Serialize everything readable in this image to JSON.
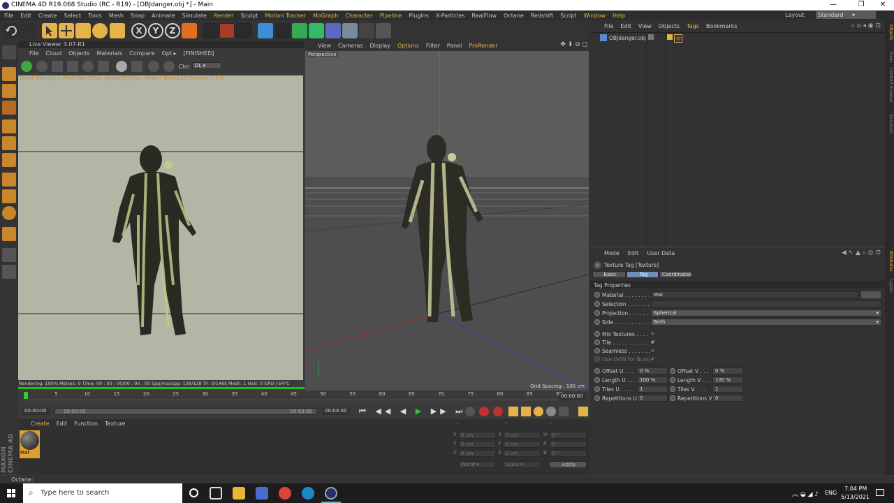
{
  "window": {
    "title": "CINEMA 4D R19.068 Studio (RC - R19) - [OBJdanger.obj *] - Main",
    "minimize": "—",
    "maximize": "❐",
    "close": "✕"
  },
  "menubar": {
    "items": [
      "File",
      "Edit",
      "Create",
      "Select",
      "Tools",
      "Mesh",
      "Snap",
      "Animate",
      "Simulate",
      "Render",
      "Sculpt",
      "Motion Tracker",
      "MoGraph",
      "Character",
      "Pipeline",
      "Plugins",
      "X-Particles",
      "RealFlow",
      "Octane",
      "Redshift",
      "Script",
      "Window",
      "Help"
    ],
    "layout_label": "Layout:",
    "layout_value": "Standard"
  },
  "live_viewer": {
    "title": "Live Viewer 3.07-R1",
    "menu": [
      "File",
      "Cloud",
      "Objects",
      "Materials",
      "Compare",
      "Opt ▸",
      "[FINISHED]"
    ],
    "chn_label": "Chn:",
    "chn_value": "DL",
    "status": "Check:0ms./1ms. MeshGen:23ms. Update[C]:0ms. Mesh:1 Nodes:13 Movable:1  0 0",
    "footer": "Rendering: 100%  Ms/sec: 0    Time: 00 : 00 : 00/00 : 00 : 00  Spp/maxspp: 128/128    Tri: 0/146k   Mesh: 1  Hair: 0      GPU:|    64°C"
  },
  "viewport": {
    "menu": [
      "View",
      "Cameras",
      "Display",
      "Options",
      "Filter",
      "Panel",
      "ProRender"
    ],
    "camera": "Perspective",
    "grid_spacing": "Grid Spacing : 100 cm"
  },
  "timeline": {
    "ticks": [
      "0",
      "5",
      "10",
      "15",
      "20",
      "25",
      "30",
      "35",
      "40",
      "45",
      "50",
      "55",
      "60",
      "65",
      "70",
      "75",
      "80",
      "85",
      "90"
    ],
    "end_frame": "00:00:00",
    "current": "00:00:00",
    "start": "00:00:00",
    "mid": "00:03:00",
    "end": "00:03:00"
  },
  "material_manager": {
    "menu": [
      "Create",
      "Edit",
      "Function",
      "Texture"
    ],
    "material_name": "Mat"
  },
  "coordinates": {
    "header_dash": "--",
    "rows": [
      {
        "a": "X",
        "av": "0 cm",
        "b": "X",
        "bv": "0 cm",
        "c": "H",
        "cv": "0 °"
      },
      {
        "a": "Y",
        "av": "0 cm",
        "b": "Y",
        "bv": "0 cm",
        "c": "P",
        "cv": "0 °"
      },
      {
        "a": "Z",
        "av": "0 cm",
        "b": "Z",
        "bv": "0 cm",
        "c": "B",
        "cv": "0 °"
      }
    ],
    "world": "World",
    "scale": "Scale",
    "apply": "Apply"
  },
  "object_manager": {
    "menu": [
      "File",
      "Edit",
      "View",
      "Objects",
      "Tags",
      "Bookmarks"
    ],
    "object_name": "OBJdanger.obj"
  },
  "attribute_manager": {
    "menu": [
      "Mode",
      "Edit",
      "User Data"
    ],
    "title": "Texture Tag [Texture]",
    "tabs": [
      "Basic",
      "Tag",
      "Coordinates"
    ],
    "section": "Tag Properties",
    "material_label": "Material . . . . . . . .",
    "material_value": "Mat",
    "selection_label": "Selection . . . . . . .",
    "projection_label": "Projection . . . . . .",
    "projection_value": "Spherical",
    "side_label": "Side . . . . . . . . . . .",
    "side_value": "Both",
    "mix_label": "Mix Textures . . . . .",
    "tile_label": "Tile . . . . . . . . . . . .",
    "seamless_label": "Seamless . . . . . . .",
    "uvw_label": "Use UVW for Bump",
    "offset_u": "Offset U . . .",
    "offset_u_val": "0 %",
    "offset_v": "Offset V . . .",
    "offset_v_val": "0 %",
    "length_u": "Length U . . .",
    "length_u_val": "100 %",
    "length_v": "Length V . . .",
    "length_v_val": "100 %",
    "tiles_u": "Tiles U . . . .",
    "tiles_u_val": "1",
    "tiles_v": "Tiles V. . . .",
    "tiles_v_val": "1",
    "rep_u": "Repetitions U",
    "rep_u_val": "0",
    "rep_v": "Repetitions V",
    "rep_v_val": "0"
  },
  "right_tabs": [
    "Objects",
    "Takes",
    "Content Browser",
    "Structure",
    "Attributes",
    "Layers"
  ],
  "statusbar": {
    "text": "Octane:"
  },
  "taskbar": {
    "search": "Type here to search",
    "lang": "ENG",
    "time": "7:04 PM",
    "date": "5/13/2021"
  },
  "colors": {
    "accent": "#e6b24a",
    "selected_tab": "#6d8dbd",
    "material_highlight": "#e0a030"
  }
}
